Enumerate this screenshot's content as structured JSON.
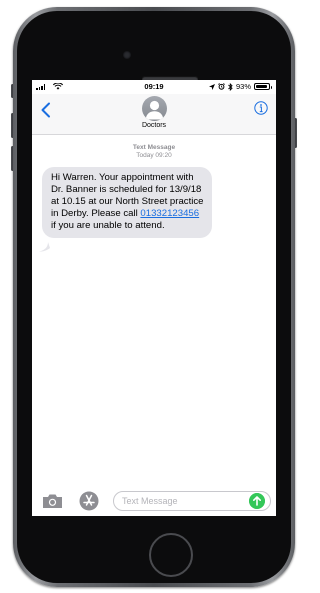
{
  "status_bar": {
    "time": "09:19",
    "battery_text": "93%",
    "battery_level_percent": 93
  },
  "header": {
    "contact_name": "Doctors",
    "back_icon": "chevron-left-icon",
    "info_icon": "info-icon"
  },
  "conversation": {
    "message_kind": "Text Message",
    "timestamp": "Today 09:20",
    "message": {
      "text_before_link": "Hi Warren. Your appointment with Dr. Banner is scheduled for 13/9/18 at 10.15 at our North Street practice in Derby. Please call ",
      "link_text": "01332123456",
      "text_after_link": " if you are unable to attend."
    }
  },
  "composer": {
    "placeholder": "Text Message",
    "value": "",
    "camera_icon": "camera-icon",
    "apps_icon": "app-store-icon",
    "send_icon": "send-arrow-icon"
  },
  "colors": {
    "accent_blue": "#1a6ee0",
    "incoming_bubble": "#e5e5ea",
    "send_green": "#34c759",
    "meta_gray": "#8e8e93"
  }
}
